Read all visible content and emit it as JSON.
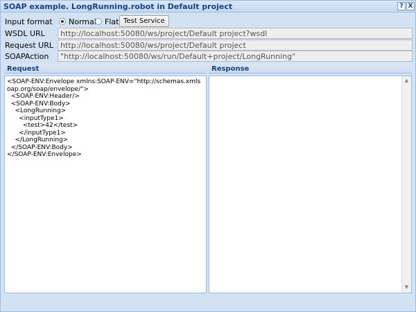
{
  "window": {
    "title": "SOAP example. LongRunning.robot in Default project",
    "help_icon": "?",
    "close_icon": "X"
  },
  "form": {
    "input_format_label": "Input format",
    "format_options": [
      {
        "label": "Normal",
        "checked": true
      },
      {
        "label": "Flat",
        "checked": false
      }
    ],
    "test_service_label": "Test Service",
    "wsdl_url_label": "WSDL URL",
    "wsdl_url_value": "http://localhost:50080/ws/project/Default project?wsdl",
    "request_url_label": "Request URL",
    "request_url_value": "http://localhost:50080/ws/project/Default project",
    "soap_action_label": "SOAPAction",
    "soap_action_value": "\"http://localhost:50080/ws/run/Default+project/LongRunning\""
  },
  "request": {
    "header": "Request",
    "body": "<SOAP-ENV:Envelope xmlns:SOAP-ENV=\"http://schemas.xmlsoap.org/soap/envelope/\">\n  <SOAP-ENV:Header/>\n  <SOAP-ENV:Body>\n    <LongRunning>\n      <inputType1>\n        <test>42</test>\n      </inputType1>\n    </LongRunning>\n  </SOAP-ENV:Body>\n</SOAP-ENV:Envelope>"
  },
  "response": {
    "header": "Response",
    "body": ""
  }
}
